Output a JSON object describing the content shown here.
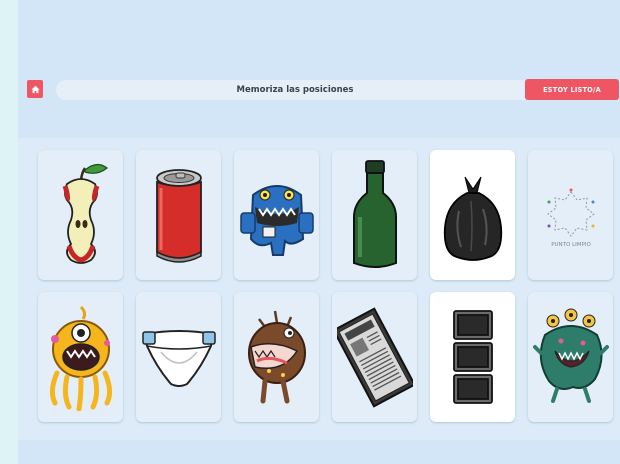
{
  "header": {
    "home_icon": "home-icon",
    "title": "Memoriza las posiciones",
    "ready_label": "ESTOY LISTO/A"
  },
  "colors": {
    "accent": "#ef5663",
    "board_bg": "#d2e6f7",
    "card_bg": "#e4eef8"
  },
  "cards": [
    {
      "item": "apple-core",
      "row": 1,
      "col": 1
    },
    {
      "item": "soda-can",
      "row": 1,
      "col": 2
    },
    {
      "item": "blue-monster",
      "row": 1,
      "col": 3
    },
    {
      "item": "green-bottle",
      "row": 1,
      "col": 4
    },
    {
      "item": "black-trash-bag",
      "row": 1,
      "col": 5
    },
    {
      "item": "punto-limpio-logo",
      "row": 1,
      "col": 6,
      "label": "PUNTO LIMPIO"
    },
    {
      "item": "yellow-monster",
      "row": 2,
      "col": 1
    },
    {
      "item": "diaper",
      "row": 2,
      "col": 2
    },
    {
      "item": "brown-monster",
      "row": 2,
      "col": 3
    },
    {
      "item": "newspaper",
      "row": 2,
      "col": 4
    },
    {
      "item": "stacked-tvs",
      "row": 2,
      "col": 5
    },
    {
      "item": "green-monster",
      "row": 2,
      "col": 6
    }
  ]
}
